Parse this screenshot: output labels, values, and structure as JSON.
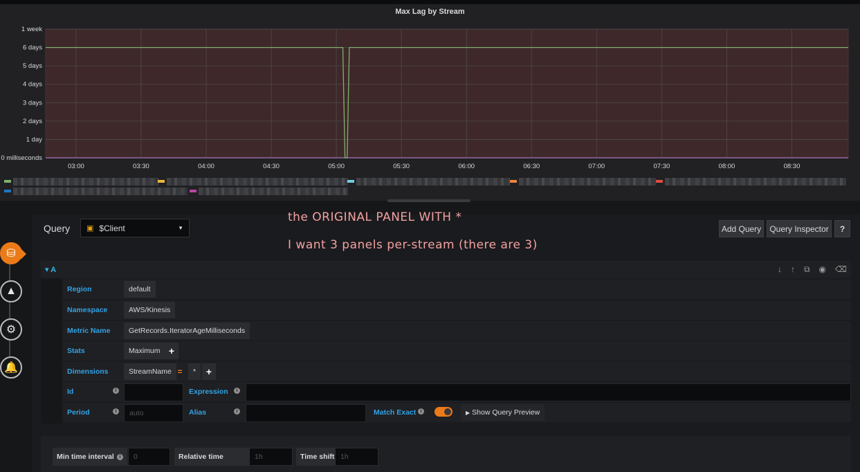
{
  "panel": {
    "title": "Max Lag by Stream"
  },
  "chart_data": {
    "type": "line",
    "title": "Max Lag by Stream",
    "y_ticks": [
      "1 week",
      "6 days",
      "5 days",
      "4 days",
      "3 days",
      "2 days",
      "1 day",
      "0 milliseconds"
    ],
    "x_ticks": [
      "03:00",
      "03:30",
      "04:00",
      "04:30",
      "05:00",
      "05:30",
      "06:00",
      "06:30",
      "07:00",
      "07:30",
      "08:00",
      "08:30"
    ],
    "ylim_days": [
      0,
      7
    ],
    "grid": true,
    "threshold_band": {
      "from_days": 0,
      "to_days": 7,
      "color": "#5a2f2f"
    },
    "series": [
      {
        "color": "#7eb26d",
        "x": [
          "02:46",
          "05:03",
          "05:04",
          "05:05",
          "05:06",
          "08:56"
        ],
        "y_days": [
          6,
          6,
          0,
          0,
          6,
          6
        ]
      },
      {
        "color": "#a05da0",
        "x": [
          "02:46",
          "08:56"
        ],
        "y_days": [
          0,
          0
        ]
      },
      {
        "color": "#6ed0e0",
        "x": [
          "02:46",
          "08:56"
        ],
        "y_days": [
          0,
          0
        ]
      }
    ]
  },
  "legend_colors": [
    "#7eb26d",
    "#eab839",
    "#6ed0e0",
    "#ef843c",
    "#e24d42",
    "#1f78c1",
    "#ba43a9"
  ],
  "query": {
    "label": "Query",
    "datasource": "$Client",
    "add_query": "Add Query",
    "query_inspector": "Query Inspector",
    "help": "?",
    "ref_id": "A"
  },
  "annotation": {
    "line1": "the ORIGINAL PANEL WITH *",
    "line2": "I want 3 panels per-stream (there are 3)"
  },
  "fields": {
    "region_label": "Region",
    "region_value": "default",
    "namespace_label": "Namespace",
    "namespace_value": "AWS/Kinesis",
    "metric_label": "Metric Name",
    "metric_value": "GetRecords.IteratorAgeMilliseconds",
    "stats_label": "Stats",
    "stats_value": "Maximum",
    "dimensions_label": "Dimensions",
    "dim_key": "StreamName",
    "dim_op": "=",
    "dim_value": "*",
    "id_label": "Id",
    "expression_label": "Expression",
    "period_label": "Period",
    "period_placeholder": "auto",
    "alias_label": "Alias",
    "match_exact_label": "Match Exact",
    "match_exact_on": true,
    "show_preview": "Show Query Preview"
  },
  "options": {
    "min_interval_label": "Min time interval",
    "min_interval_placeholder": "0",
    "relative_time_label": "Relative time",
    "relative_time_placeholder": "1h",
    "time_shift_label": "Time shift",
    "time_shift_placeholder": "1h"
  }
}
